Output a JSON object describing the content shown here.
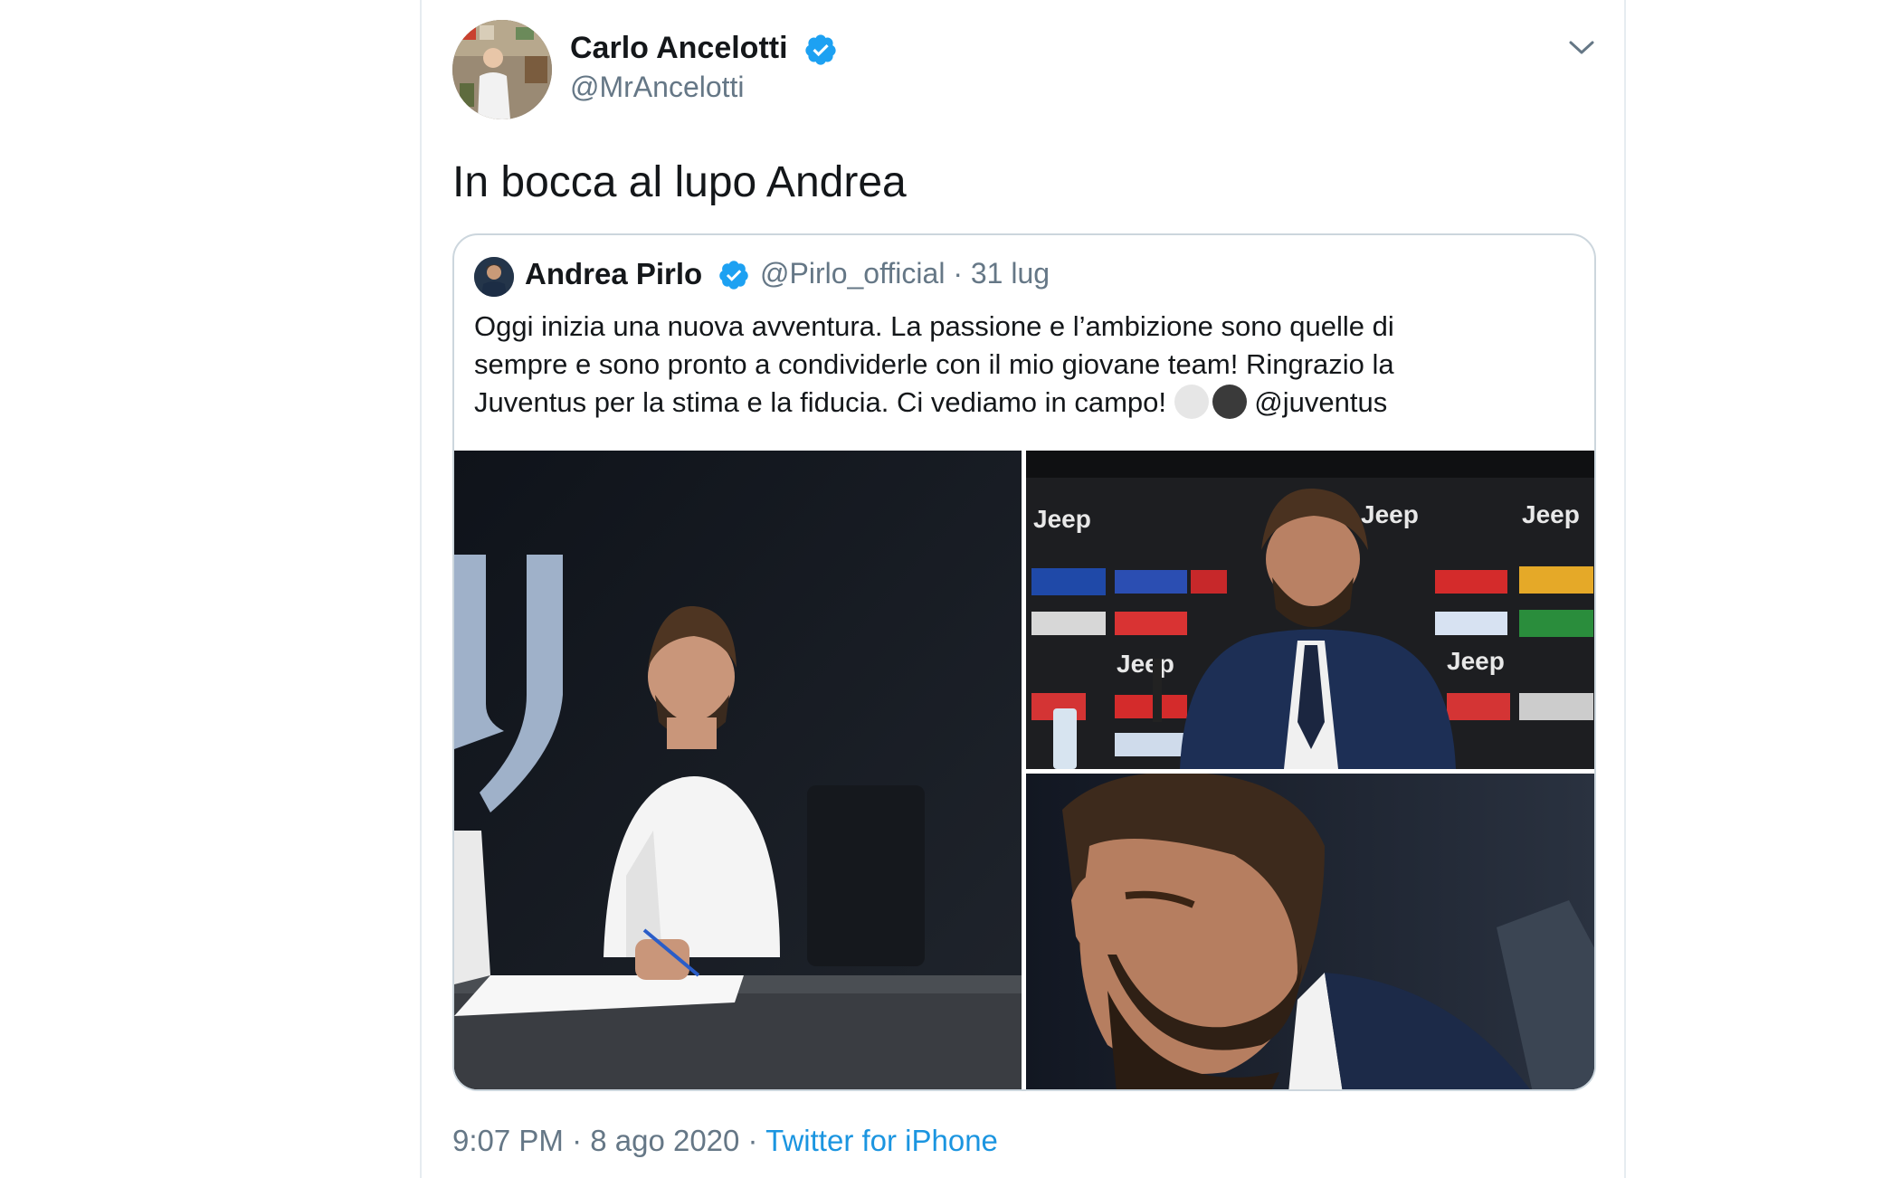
{
  "tweet": {
    "author": {
      "name": "Carlo Ancelotti",
      "handle": "@MrAncelotti",
      "verified": true,
      "avatar": "avatar-carlo-ancelotti"
    },
    "text": "In bocca al lupo Andrea",
    "menu_icon": "chevron-down-icon",
    "quoted": {
      "author": {
        "name": "Andrea Pirlo",
        "handle": "@Pirlo_official",
        "verified": true
      },
      "date": "31 lug",
      "separator": "·",
      "text_lines": [
        "Oggi inizia una nuova avventura. La passione e l’ambizione sono quelle di",
        "sempre e sono pronto a condividerle con il mio giovane team! Ringrazio la",
        "Juventus per la stima e la fiducia. Ci vediamo in campo!"
      ],
      "emoji": [
        "white-circle",
        "black-circle"
      ],
      "mention": "@juventus",
      "photos": [
        {
          "name": "photo-pirlo-signing-contract",
          "alt": "Andrea Pirlo signing a contract in front of the Juventus J logo"
        },
        {
          "name": "photo-pirlo-press-conference",
          "alt": "Andrea Pirlo at a press conference in front of sponsor board"
        },
        {
          "name": "photo-pirlo-closeup",
          "alt": "Close-up of Andrea Pirlo"
        }
      ]
    },
    "timestamp": "9:07 PM · 8 ago 2020 ·",
    "source": "Twitter for iPhone"
  },
  "colors": {
    "text": "#14171a",
    "secondary": "#657786",
    "link": "#1b95e0",
    "verified": "#1da1f2",
    "border": "#ccd6dd"
  }
}
